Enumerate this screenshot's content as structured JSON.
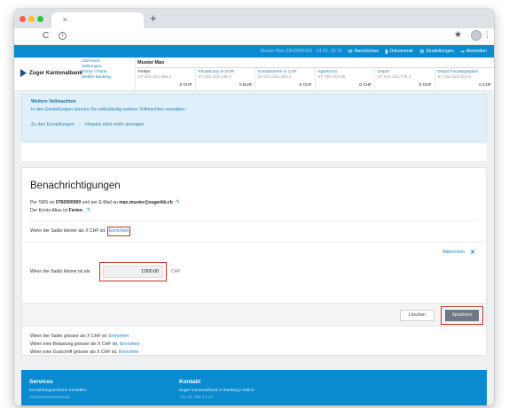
{
  "browser": {
    "new_tab": "+",
    "reload": "C",
    "info": "i",
    "star": "★",
    "menu": "⋮"
  },
  "topbar": {
    "user_session": "Muster Max   93H0045290 - 14.03. 10:16",
    "messages": "Nachrichten",
    "documents": "Dokumente",
    "settings": "Einstellungen",
    "logout": "Abmelden"
  },
  "header": {
    "bank_name": "Zuger Kantonalbank",
    "nav": [
      "Übersicht",
      "Zahlungen",
      "Börse / Fläne",
      "Mobile Banking"
    ],
    "account_holder": "Muster Max",
    "accounts": [
      {
        "name": "Ferien",
        "number": "57.202.324.366.1",
        "balance": "0 CHF"
      },
      {
        "name": "Privatkonto in EUR",
        "number": "57.202.324.448.0",
        "balance": "0 EUR"
      },
      {
        "name": "Kontokorrent in CHF",
        "number": "57.202.324.364.3",
        "balance": "0 CHF"
      },
      {
        "name": "Sparkonto",
        "number": "57.796.243.05",
        "balance": "0 CHF"
      },
      {
        "name": "Depot",
        "number": "57.202.324.776.1",
        "balance": "0 CHF"
      },
      {
        "name": "Depot Fondssparplan",
        "number": "57.202.324.314.5",
        "balance": "0 CHF"
      }
    ]
  },
  "info": {
    "title": "Weitere Vollmachten",
    "text": "In den Einstellungen können Sie selbständig weitere Vollmachten verwalten.",
    "link_settings": "Zu den Einstellungen",
    "separator": "|",
    "link_dismiss": "Hinweis nicht mehr anzeigen"
  },
  "card": {
    "title": "Benachrichtigungen",
    "contact_prefix": "Per SMS an ",
    "phone": "0760000000",
    "contact_middle": " und per E-Mail an ",
    "email": "max.muster@zugerkb.ch",
    "alias_prefix": "Der Konto-Alias ist ",
    "alias": "Ferien",
    "alias_suffix": ".",
    "rule_saldo_smaller": "Wenn der Saldo kleiner als X CHF ist.",
    "einrichten": "Einrichten",
    "cancel": "Abbrechen",
    "field_label": "Wenn der Saldo kleiner ist als",
    "field_value": "1'000.00",
    "field_unit": "CHF",
    "delete": "Löschen",
    "save": "Speichern",
    "rules": [
      {
        "text": "Wenn der Saldo grösser als X CHF ist.",
        "action": "Einrichten"
      },
      {
        "text": "Wenn eine Belastung grösser als X CHF ist.",
        "action": "Einrichten"
      },
      {
        "text": "Wenn eine Gutschrift grösser als X CHF ist.",
        "action": "Einrichten"
      }
    ]
  },
  "footer": {
    "services_title": "Services",
    "services_item": "Einzahlungsscheine bestellen",
    "services_item2": "Sicherheitsmerkmale",
    "contact_title": "Kontakt",
    "contact_item": "Zuger Kantonalbank E-Banking Hotline",
    "contact_item2": "+41 41 709 14 14"
  },
  "colors": {
    "brand_blue": "#0a8bd0",
    "highlight_red": "#c8322b",
    "save_button": "#6d7882"
  }
}
